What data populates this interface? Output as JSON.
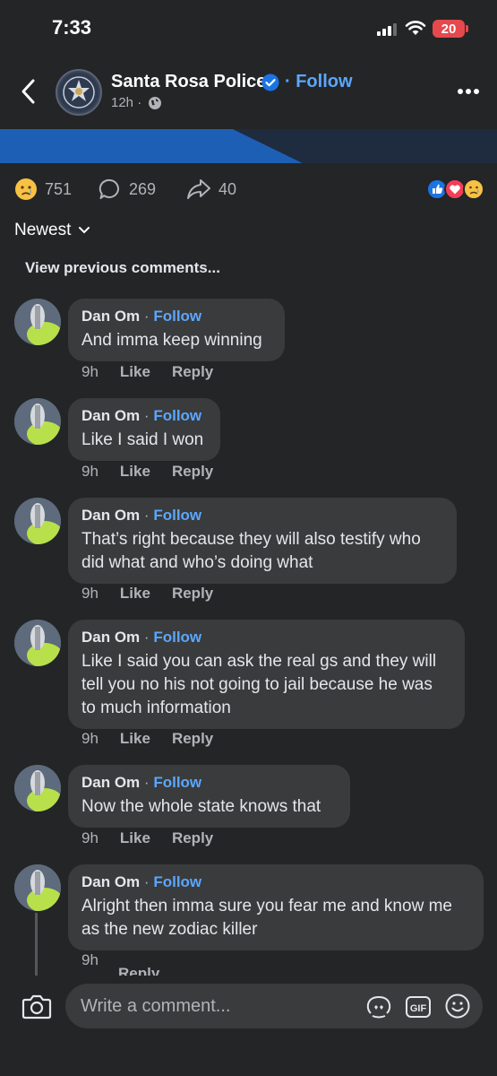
{
  "status": {
    "time": "7:33",
    "battery": "20"
  },
  "header": {
    "page_name": "Santa Rosa Police",
    "follow": "Follow",
    "time": "12h",
    "dot": "·"
  },
  "reactions": {
    "count": "751",
    "comments": "269",
    "shares": "40"
  },
  "sort": {
    "label": "Newest"
  },
  "view_previous": "View previous comments...",
  "comments": [
    {
      "author": "Dan Om",
      "follow": "Follow",
      "text": "And imma keep winning",
      "time": "9h",
      "like": "Like",
      "reply": "Reply"
    },
    {
      "author": "Dan Om",
      "follow": "Follow",
      "text": "Like I said I won",
      "time": "9h",
      "like": "Like",
      "reply": "Reply"
    },
    {
      "author": "Dan Om",
      "follow": "Follow",
      "text": "That’s right because they will also testify who did what and who’s doing what",
      "time": "9h",
      "like": "Like",
      "reply": "Reply"
    },
    {
      "author": "Dan Om",
      "follow": "Follow",
      "text": "Like I said you can ask the real gs and they will tell you no his not going to jail because he was to much information",
      "time": "9h",
      "like": "Like",
      "reply": "Reply"
    },
    {
      "author": "Dan Om",
      "follow": "Follow",
      "text": "Now the whole state knows that",
      "time": "9h",
      "like": "Like",
      "reply": "Reply"
    },
    {
      "author": "Dan Om",
      "follow": "Follow",
      "text": "Alright then imma sure you fear me and know me as the new zodiac killer",
      "time": "9h",
      "like": "",
      "reply": "Reply"
    }
  ],
  "composer": {
    "placeholder": "Write a comment..."
  },
  "colors": {
    "background": "#242526",
    "bubble": "#3a3b3c",
    "link": "#5aa7ff",
    "verified": "#1b74e4"
  },
  "icons": [
    "back-icon",
    "verified-icon",
    "globe-icon",
    "more-icon",
    "sad-reaction-icon",
    "comment-icon",
    "share-icon",
    "like-reaction-icon",
    "love-reaction-icon",
    "camera-icon",
    "avatar-sticker-icon",
    "gif-icon",
    "emoji-icon",
    "chevron-down-icon",
    "signal-icon",
    "wifi-icon",
    "battery-icon"
  ]
}
